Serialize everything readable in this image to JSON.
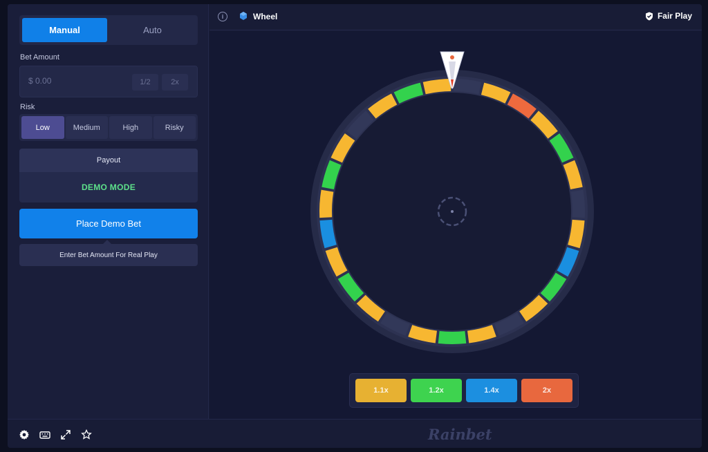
{
  "sidebar": {
    "modes": [
      "Manual",
      "Auto"
    ],
    "active_mode": "Manual",
    "bet_amount_label": "Bet Amount",
    "bet_amount_placeholder": "$ 0.00",
    "half_label": "1/2",
    "double_label": "2x",
    "risk_label": "Risk",
    "risk_options": [
      "Low",
      "Medium",
      "High",
      "Risky"
    ],
    "active_risk": "Low",
    "payout_label": "Payout",
    "payout_value": "DEMO MODE",
    "place_bet_label": "Place Demo Bet",
    "hint_label": "Enter Bet Amount For Real Play"
  },
  "topbar": {
    "info_icon": "i",
    "game_title": "Wheel",
    "fair_play_label": "Fair Play"
  },
  "wheel": {
    "segments": [
      "gray",
      "yellow",
      "orange",
      "yellow",
      "green",
      "yellow",
      "gray",
      "yellow",
      "blue",
      "green",
      "yellow",
      "gray",
      "yellow",
      "green",
      "yellow",
      "gray",
      "yellow",
      "green",
      "yellow",
      "blue",
      "yellow",
      "green",
      "yellow",
      "gray",
      "yellow",
      "green",
      "yellow"
    ],
    "colors": {
      "yellow": "#f7b731",
      "green": "#33d24d",
      "blue": "#1a8fe0",
      "orange": "#ee6a3e",
      "gray": "#323859"
    }
  },
  "multipliers": [
    {
      "label": "1.1x",
      "color": "#e7b132"
    },
    {
      "label": "1.2x",
      "color": "#3ed34f"
    },
    {
      "label": "1.4x",
      "color": "#1c8fe0"
    },
    {
      "label": "2x",
      "color": "#e8683e"
    }
  ],
  "footer": {
    "brand": "Rainbet",
    "icons": [
      "settings-icon",
      "keyboard-icon",
      "fullscreen-icon",
      "favorite-icon"
    ]
  }
}
